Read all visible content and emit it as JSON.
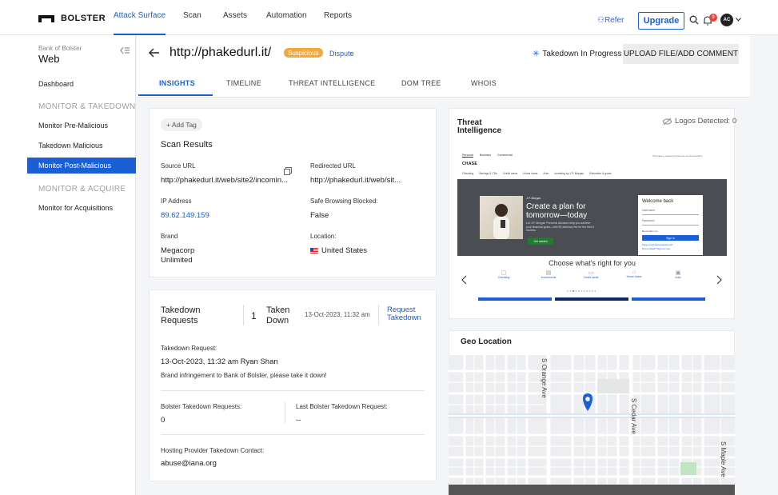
{
  "brand": {
    "name": "BOLSTER"
  },
  "nav": {
    "items": [
      "Attack Surface",
      "Scan",
      "Assets",
      "Automation",
      "Reports"
    ],
    "refer": "Refer",
    "upgrade": "Upgrade",
    "notif_count": "9",
    "avatar": "AC"
  },
  "sidebar": {
    "org": "Bank of Bolster",
    "product": "Web",
    "dashboard": "Dashboard",
    "section1": "MONITOR & TAKEDOWN",
    "items1": [
      "Monitor Pre-Malicious",
      "Takedown Malicious",
      "Monitor Post-Malicious"
    ],
    "section2": "MONITOR & ACQUIRE",
    "items2": [
      "Monitor for Acquisitions"
    ]
  },
  "header": {
    "url": "http://phakedurl.it/",
    "status": "Suspicious",
    "dispute": "Dispute",
    "takedown_status": "Takedown In Progress",
    "upload_btn": "UPLOAD FILE/ADD COMMENT",
    "tabs": [
      "INSIGHTS",
      "TIMELINE",
      "THREAT INTELLIGENCE",
      "DOM TREE",
      "WHOIS"
    ]
  },
  "scan": {
    "add_tag": "+ Add Tag",
    "title": "Scan Results",
    "source_url_label": "Source URL",
    "source_url": "http://phakedurl.it/web/site2/incomin...",
    "redirected_url_label": "Redirected URL",
    "redirected_url": "http://phakedurl.it/web/sit...",
    "ip_label": "IP Address",
    "ip": "89.62.149.159",
    "safe_label": "Safe Browsing Blocked:",
    "safe": "False",
    "brand_label": "Brand",
    "brand_line1": "Megacorp",
    "brand_line2": "Unlimited",
    "location_label": "Location:",
    "location": "United States"
  },
  "takedown": {
    "title_line1": "Takedown",
    "title_line2": "Requests",
    "count": "1",
    "taken_line1": "Taken",
    "taken_line2": "Down",
    "date": "13-Oct-2023, 11:32 am",
    "request_line1": "Request",
    "request_line2": "Takedown",
    "req_label": "Takedown Request:",
    "req_meta": "13-Oct-2023, 11:32 am Ryan Shan",
    "req_text": "Brand infringement to Bank of Bolster, please take it down!",
    "bolster_label": "Bolster Takedown Requests:",
    "bolster_val": "0",
    "last_label": "Last Bolster Takedown Request:",
    "last_val": "--",
    "hosting_label": "Hosting Provider Takedown Contact:",
    "hosting_val": "abuse@iana.org"
  },
  "threat": {
    "title_line1": "Threat",
    "title_line2": "Intelligence",
    "logos": "Logos Detected: 0"
  },
  "chase": {
    "tabs": [
      "Personal",
      "Business",
      "Commercial"
    ],
    "top_right": "Schedule a meeting    Customer service    Español",
    "logo": "CHASE",
    "menu": [
      "Checking",
      "Savings & CDs",
      "Credit cards",
      "Home loans",
      "Auto",
      "Investing by J.P. Morgan",
      "Education & goals"
    ],
    "jpm": "J.P. Morgan",
    "headline1": "Create a plan for",
    "headline2": "tomorrow—today",
    "sub": "Let J.P. Morgan Personal Advisors help you achieve your financial goals—with $0 advisory fee for the first 6 months.",
    "cta": "Get started",
    "welcome": "Welcome back",
    "username": "Username",
    "password": "Password",
    "remember": "Remember me",
    "signin": "Sign in",
    "forgot": "Forgot username/password?",
    "notenrolled": "Not enrolled? Sign up now",
    "choose": "Choose what's right for you",
    "cats": [
      "Checking",
      "Investments",
      "Credit cards",
      "Home loans",
      "Auto"
    ]
  },
  "geo": {
    "title": "Geo Location",
    "streets": [
      "S Orange Ave",
      "S Cedar Ave",
      "S Maple Ave"
    ]
  }
}
